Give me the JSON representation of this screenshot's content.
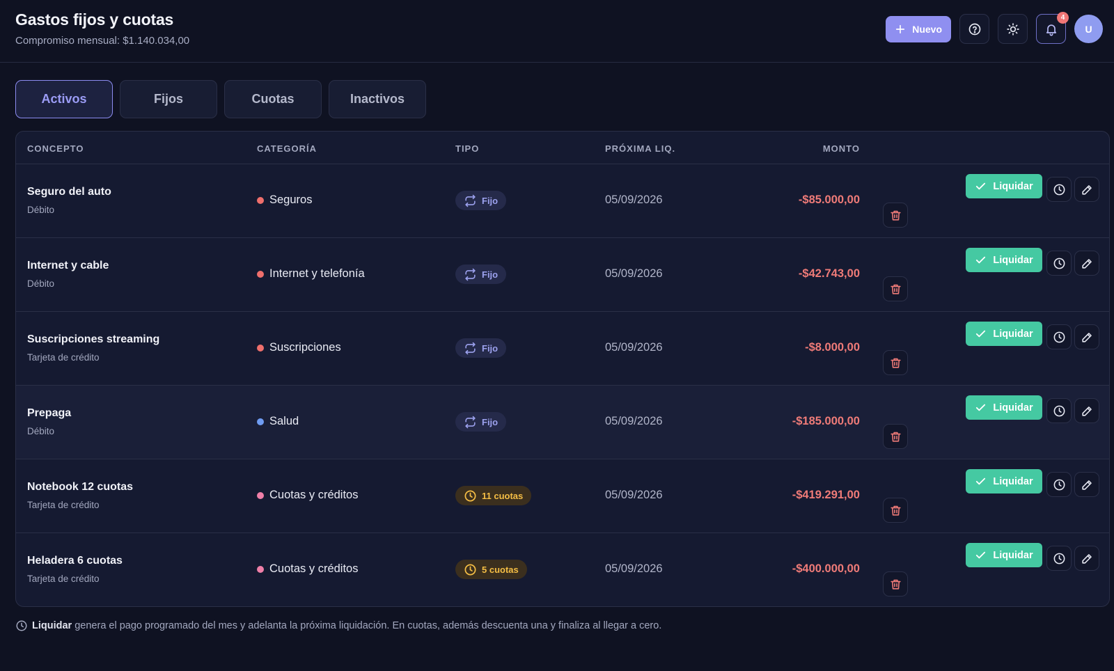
{
  "header": {
    "title": "Gastos fijos y cuotas",
    "subtitle": "Compromiso mensual: $1.140.034,00",
    "new_button_label": "Nuevo",
    "notifications_count": "4",
    "avatar_initial": "U"
  },
  "tabs": [
    {
      "label": "Activos",
      "active": true
    },
    {
      "label": "Fijos",
      "active": false
    },
    {
      "label": "Cuotas",
      "active": false
    },
    {
      "label": "Inactivos",
      "active": false
    }
  ],
  "table": {
    "headers": {
      "concepto": "CONCEPTO",
      "categoria": "CATEGORÍA",
      "tipo": "TIPO",
      "proxima": "PRÓXIMA LIQ.",
      "monto": "MONTO"
    },
    "liquidar_label": "Liquidar",
    "rows": [
      {
        "name": "Seguro del auto",
        "method": "Débito",
        "category": "Seguros",
        "category_color": "#ef6f6c",
        "type_kind": "fijo",
        "type_label": "Fijo",
        "next": "05/09/2026",
        "amount": "-$85.000,00"
      },
      {
        "name": "Internet y cable",
        "method": "Débito",
        "category": "Internet y telefonía",
        "category_color": "#ef6f6c",
        "type_kind": "fijo",
        "type_label": "Fijo",
        "next": "05/09/2026",
        "amount": "-$42.743,00"
      },
      {
        "name": "Suscripciones streaming",
        "method": "Tarjeta de crédito",
        "category": "Suscripciones",
        "category_color": "#ef6f6c",
        "type_kind": "fijo",
        "type_label": "Fijo",
        "next": "05/09/2026",
        "amount": "-$8.000,00"
      },
      {
        "name": "Prepaga",
        "method": "Débito",
        "category": "Salud",
        "category_color": "#6f9cf2",
        "type_kind": "fijo",
        "type_label": "Fijo",
        "next": "05/09/2026",
        "amount": "-$185.000,00"
      },
      {
        "name": "Notebook 12 cuotas",
        "method": "Tarjeta de crédito",
        "category": "Cuotas y créditos",
        "category_color": "#ef7fa8",
        "type_kind": "cuotas",
        "type_label": "11 cuotas",
        "next": "05/09/2026",
        "amount": "-$419.291,00"
      },
      {
        "name": "Heladera 6 cuotas",
        "method": "Tarjeta de crédito",
        "category": "Cuotas y créditos",
        "category_color": "#ef7fa8",
        "type_kind": "cuotas",
        "type_label": "5 cuotas",
        "next": "05/09/2026",
        "amount": "-$400.000,00"
      }
    ]
  },
  "footer": {
    "bold": "Liquidar",
    "text": "genera el pago programado del mes y adelanta la próxima liquidación. En cuotas, además descuenta una y finaliza al llegar a cero."
  },
  "colors": {
    "accent": "#8f8ff0",
    "liquidar": "#45c9a2",
    "amount": "#ef7b78",
    "cuotas": "#f5be45"
  },
  "icons": [
    "plus-icon",
    "help-icon",
    "sun-icon",
    "bell-icon",
    "repeat-icon",
    "clock-icon",
    "check-icon",
    "history-icon",
    "pencil-icon",
    "trash-icon",
    "info-clock-icon"
  ]
}
